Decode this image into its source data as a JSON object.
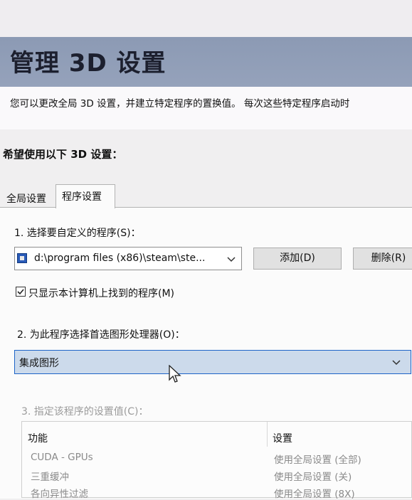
{
  "header": {
    "title": "管理 3D 设置"
  },
  "description": "您可以更改全局 3D 设置，并建立特定程序的置换值。 每次这些特定程序启动时",
  "subtitle": "希望使用以下 3D 设置：",
  "tabs": [
    {
      "label": "全局设置",
      "active": false
    },
    {
      "label": "程序设置",
      "active": true
    }
  ],
  "program_settings": {
    "step1_label": "1. 选择要自定义的程序(S)：",
    "program_select_value": "d:\\program files (x86)\\steam\\ste...",
    "add_button": "添加(D)",
    "remove_button": "删除(R)",
    "show_found_only_label": "只显示本计算机上找到的程序(M)",
    "show_found_only_checked": true,
    "step2_label": "2. 为此程序选择首选图形处理器(O)：",
    "gpu_select_value": "集成图形",
    "step3_label": "3. 指定该程序的设置值(C)：",
    "table_headers": {
      "feature": "功能",
      "setting": "设置"
    },
    "rows": [
      {
        "feature": "CUDA - GPUs",
        "setting": "使用全局设置 (全部)"
      },
      {
        "feature": "三重缓冲",
        "setting": "使用全局设置 (关)"
      },
      {
        "feature": "各向异性过滤",
        "setting": "使用全局设置 (8X)"
      }
    ]
  },
  "colors": {
    "header_bg": "#8f9db7",
    "selected_combo_bg": "#ccdaeb",
    "selected_combo_border": "#1e64c8"
  }
}
